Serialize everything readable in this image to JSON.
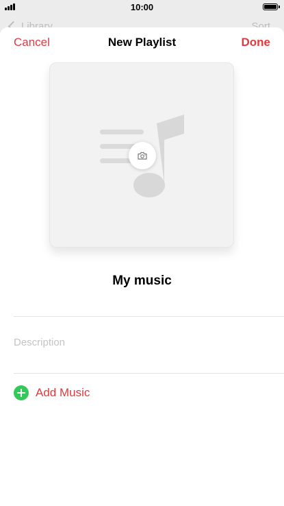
{
  "status_bar": {
    "time": "10:00"
  },
  "background_page": {
    "back_label": "Library",
    "sort_label": "Sort"
  },
  "nav": {
    "cancel_label": "Cancel",
    "title": "New Playlist",
    "done_label": "Done"
  },
  "artwork": {
    "icon": "music-note-placeholder",
    "camera_icon": "camera-icon"
  },
  "playlist": {
    "name": "My music",
    "description_placeholder": "Description"
  },
  "actions": {
    "add_music_label": "Add Music",
    "add_icon": "plus-circle-icon"
  },
  "colors": {
    "accent": "#e0393e",
    "add_icon_bg": "#34c759",
    "placeholder_text": "#c4c4c4",
    "artwork_bg": "#f2f2f2"
  }
}
